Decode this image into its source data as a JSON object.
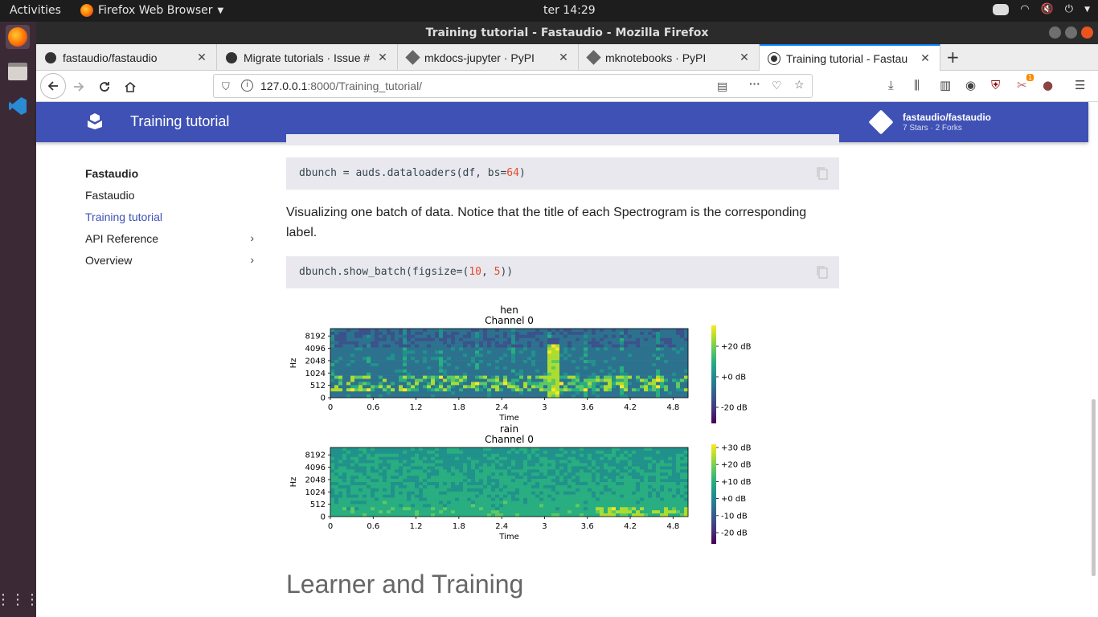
{
  "system": {
    "activities": "Activities",
    "app_name": "Firefox Web Browser",
    "clock": "ter 14:29"
  },
  "window": {
    "title": "Training tutorial - Fastaudio - Mozilla Firefox"
  },
  "tabs": [
    {
      "label": "fastaudio/fastaudio",
      "icon": "github-icon",
      "active": false
    },
    {
      "label": "Migrate tutorials · Issue #",
      "icon": "github-icon",
      "active": false
    },
    {
      "label": "mkdocs-jupyter · PyPI",
      "icon": "pypi-icon",
      "active": false
    },
    {
      "label": "mknotebooks · PyPI",
      "icon": "pypi-icon",
      "active": false
    },
    {
      "label": "Training tutorial - Fastau",
      "icon": "mkdocs-icon",
      "active": true
    }
  ],
  "url": {
    "host": "127.0.0.1",
    "path": ":8000/Training_tutorial/"
  },
  "extension_badge": "1",
  "site": {
    "header_title": "Training tutorial",
    "repo_name": "fastaudio/fastaudio",
    "repo_facts": "7 Stars · 2 Forks"
  },
  "sidebar": {
    "items": [
      {
        "label": "Fastaudio",
        "kind": "heading"
      },
      {
        "label": "Fastaudio"
      },
      {
        "label": "Training tutorial",
        "active": true
      },
      {
        "label": "API Reference",
        "expandable": true
      },
      {
        "label": "Overview",
        "expandable": true
      }
    ]
  },
  "content": {
    "code1": {
      "pre": "dbunch = auds.dataloaders(df, bs=",
      "num": "64",
      "post": ")"
    },
    "paragraph": "Visualizing one batch of data. Notice that the title of each Spectrogram is the corresponding label.",
    "code2": {
      "pre": "dbunch.show_batch(figsize=(",
      "num1": "10",
      "mid": ", ",
      "num2": "5",
      "post": "))"
    },
    "heading": "Learner and Training"
  },
  "chart_data": [
    {
      "type": "heatmap",
      "title": "hen",
      "subtitle": "Channel 0",
      "xlabel": "Time",
      "ylabel": "Hz",
      "x_ticks": [
        "0",
        "0.6",
        "1.2",
        "1.8",
        "2.4",
        "3",
        "3.6",
        "4.2",
        "4.8"
      ],
      "y_ticks": [
        "0",
        "512",
        "1024",
        "2048",
        "4096",
        "8192"
      ],
      "colorbar_ticks": [
        "+20 dB",
        "+0 dB",
        "-20 dB"
      ],
      "colormap": "viridis"
    },
    {
      "type": "heatmap",
      "title": "rain",
      "subtitle": "Channel 0",
      "xlabel": "Time",
      "ylabel": "Hz",
      "x_ticks": [
        "0",
        "0.6",
        "1.2",
        "1.8",
        "2.4",
        "3",
        "3.6",
        "4.2",
        "4.8"
      ],
      "y_ticks": [
        "0",
        "512",
        "1024",
        "2048",
        "4096",
        "8192"
      ],
      "colorbar_ticks": [
        "+30 dB",
        "+20 dB",
        "+10 dB",
        "+0 dB",
        "-10 dB",
        "-20 dB"
      ],
      "colormap": "viridis"
    }
  ]
}
